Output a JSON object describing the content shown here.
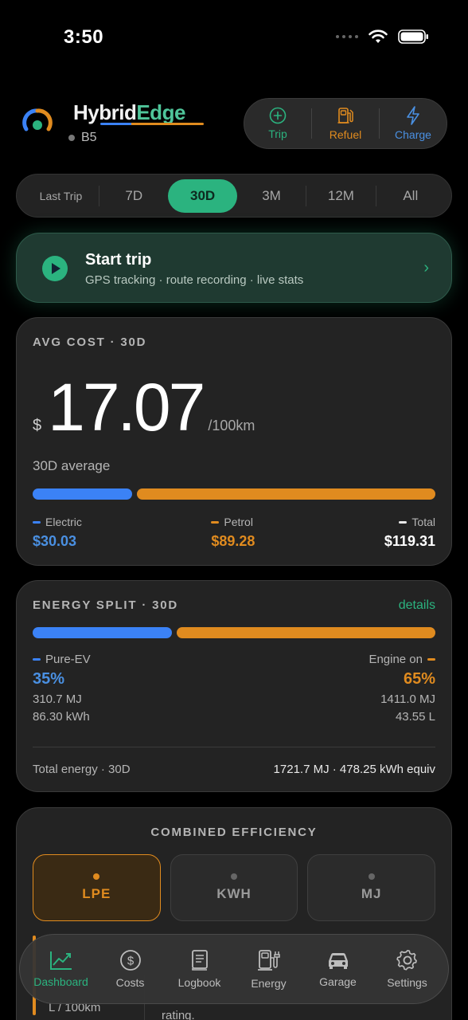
{
  "status": {
    "time": "3:50"
  },
  "header": {
    "brand_h": "Hybrid",
    "brand_e": "Edge",
    "model": "B5"
  },
  "quick_actions": [
    {
      "label": "Trip",
      "color": "#2bb37f",
      "icon": "plus-circle-icon"
    },
    {
      "label": "Refuel",
      "color": "#e08b1f",
      "icon": "fuel-pump-icon"
    },
    {
      "label": "Charge",
      "color": "#4a90e2",
      "icon": "lightning-icon"
    }
  ],
  "range": {
    "items": [
      "Last Trip",
      "7D",
      "30D",
      "3M",
      "12M",
      "All"
    ],
    "active": "30D"
  },
  "start_trip": {
    "title": "Start trip",
    "subtitle": "GPS tracking · route recording · live stats"
  },
  "avg_cost": {
    "title": "AVG COST · 30D",
    "currency": "$",
    "value": "17.07",
    "unit": "/100km",
    "label": "30D average",
    "electric_share": 0.25,
    "electric_label": "Electric",
    "electric_value": "$30.03",
    "petrol_label": "Petrol",
    "petrol_value": "$89.28",
    "total_label": "Total",
    "total_value": "$119.31"
  },
  "energy_split": {
    "title": "ENERGY SPLIT · 30D",
    "details": "details",
    "ev_label": "Pure-EV",
    "ev_pct": "35%",
    "ev_share": 0.35,
    "ev_mj": "310.7 MJ",
    "ev_kwh": "86.30 kWh",
    "engine_label": "Engine on",
    "engine_pct": "65%",
    "engine_mj": "1411.0 MJ",
    "engine_l": "43.55 L",
    "total_label": "Total energy · 30D",
    "total_value": "1721.7 MJ · 478.25 kWh equiv"
  },
  "efficiency": {
    "title": "COMBINED EFFICIENCY",
    "options": [
      "LPE",
      "KWH",
      "MJ"
    ],
    "active": "LPE",
    "peek_left": "L / 100km",
    "peek_right": "rating."
  },
  "tabs": [
    {
      "label": "Dashboard",
      "icon": "chart-trend-icon"
    },
    {
      "label": "Costs",
      "icon": "dollar-circle-icon"
    },
    {
      "label": "Logbook",
      "icon": "book-icon"
    },
    {
      "label": "Energy",
      "icon": "fuel-charge-icon"
    },
    {
      "label": "Garage",
      "icon": "car-icon"
    },
    {
      "label": "Settings",
      "icon": "gear-icon"
    }
  ],
  "colors": {
    "accent": "#2bb37f",
    "electric": "#3b82f6",
    "petrol": "#e08b1f"
  }
}
